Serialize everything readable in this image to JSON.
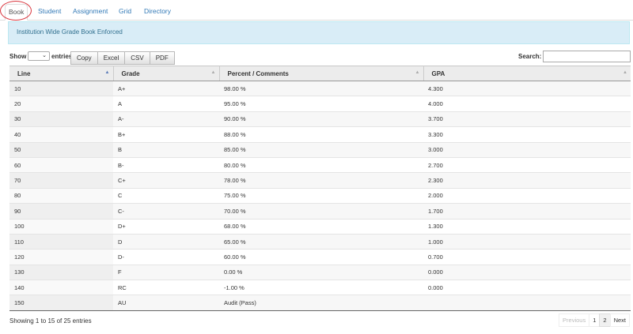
{
  "tabs": [
    {
      "label": "Book",
      "active": true
    },
    {
      "label": "Student"
    },
    {
      "label": "Assignment"
    },
    {
      "label": "Grid"
    },
    {
      "label": "Directory"
    }
  ],
  "alert": {
    "text": "Institution Wide Grade Book Enforced"
  },
  "controls": {
    "show_label": "Show",
    "entries_label": "entries",
    "buttons": [
      "Copy",
      "Excel",
      "CSV",
      "PDF"
    ],
    "search_label": "Search:",
    "search_value": ""
  },
  "table": {
    "columns": [
      "Line",
      "Grade",
      "Percent / Comments",
      "GPA"
    ],
    "rows": [
      [
        "10",
        "A+",
        "98.00 %",
        "4.300"
      ],
      [
        "20",
        "A",
        "95.00 %",
        "4.000"
      ],
      [
        "30",
        "A-",
        "90.00 %",
        "3.700"
      ],
      [
        "40",
        "B+",
        "88.00 %",
        "3.300"
      ],
      [
        "50",
        "B",
        "85.00 %",
        "3.000"
      ],
      [
        "60",
        "B-",
        "80.00 %",
        "2.700"
      ],
      [
        "70",
        "C+",
        "78.00 %",
        "2.300"
      ],
      [
        "80",
        "C",
        "75.00 %",
        "2.000"
      ],
      [
        "90",
        "C-",
        "70.00 %",
        "1.700"
      ],
      [
        "100",
        "D+",
        "68.00 %",
        "1.300"
      ],
      [
        "110",
        "D",
        "65.00 %",
        "1.000"
      ],
      [
        "120",
        "D-",
        "60.00 %",
        "0.700"
      ],
      [
        "130",
        "F",
        "0.00 %",
        "0.000"
      ],
      [
        "140",
        "RC",
        "-1.00 %",
        "0.000"
      ],
      [
        "150",
        "AU",
        "Audit (Pass)",
        ""
      ]
    ]
  },
  "footer": {
    "info": "Showing 1 to 15 of 25 entries",
    "pagination": {
      "previous": "Previous",
      "pages": [
        "1",
        "2"
      ],
      "next": "Next"
    }
  }
}
